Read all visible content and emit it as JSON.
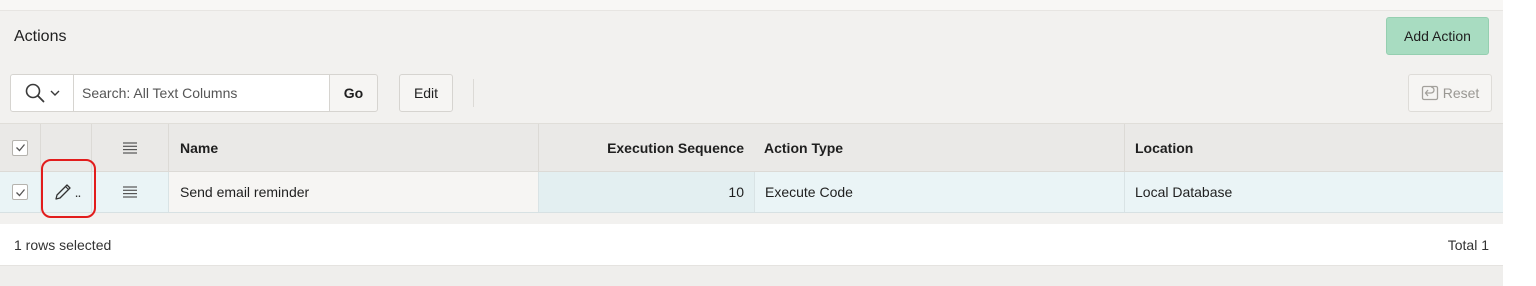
{
  "region": {
    "title": "Actions",
    "add_button_label": "Add Action"
  },
  "toolbar": {
    "search_placeholder": "Search: All Text Columns",
    "go_label": "Go",
    "edit_label": "Edit",
    "reset_label": "Reset"
  },
  "grid": {
    "columns": {
      "name": "Name",
      "execution_sequence": "Execution Sequence",
      "action_type": "Action Type",
      "location": "Location"
    },
    "rows": [
      {
        "selected": true,
        "name": "Send email reminder",
        "execution_sequence": "10",
        "action_type": "Execute Code",
        "location": "Local Database"
      }
    ]
  },
  "footer": {
    "selection_status": "1 rows selected",
    "total": "Total 1"
  },
  "icons": {
    "search": "search-icon",
    "chevron": "chevron-down-icon",
    "checkbox": "checkmark-icon",
    "row_menu": "hamburger-menu-icon",
    "edit_row": "pencil-icon",
    "reset": "reset-icon"
  },
  "colors": {
    "primary_button": "#a8dcc1",
    "selected_row": "#eaf4f6",
    "highlight": "#e21c1c"
  }
}
